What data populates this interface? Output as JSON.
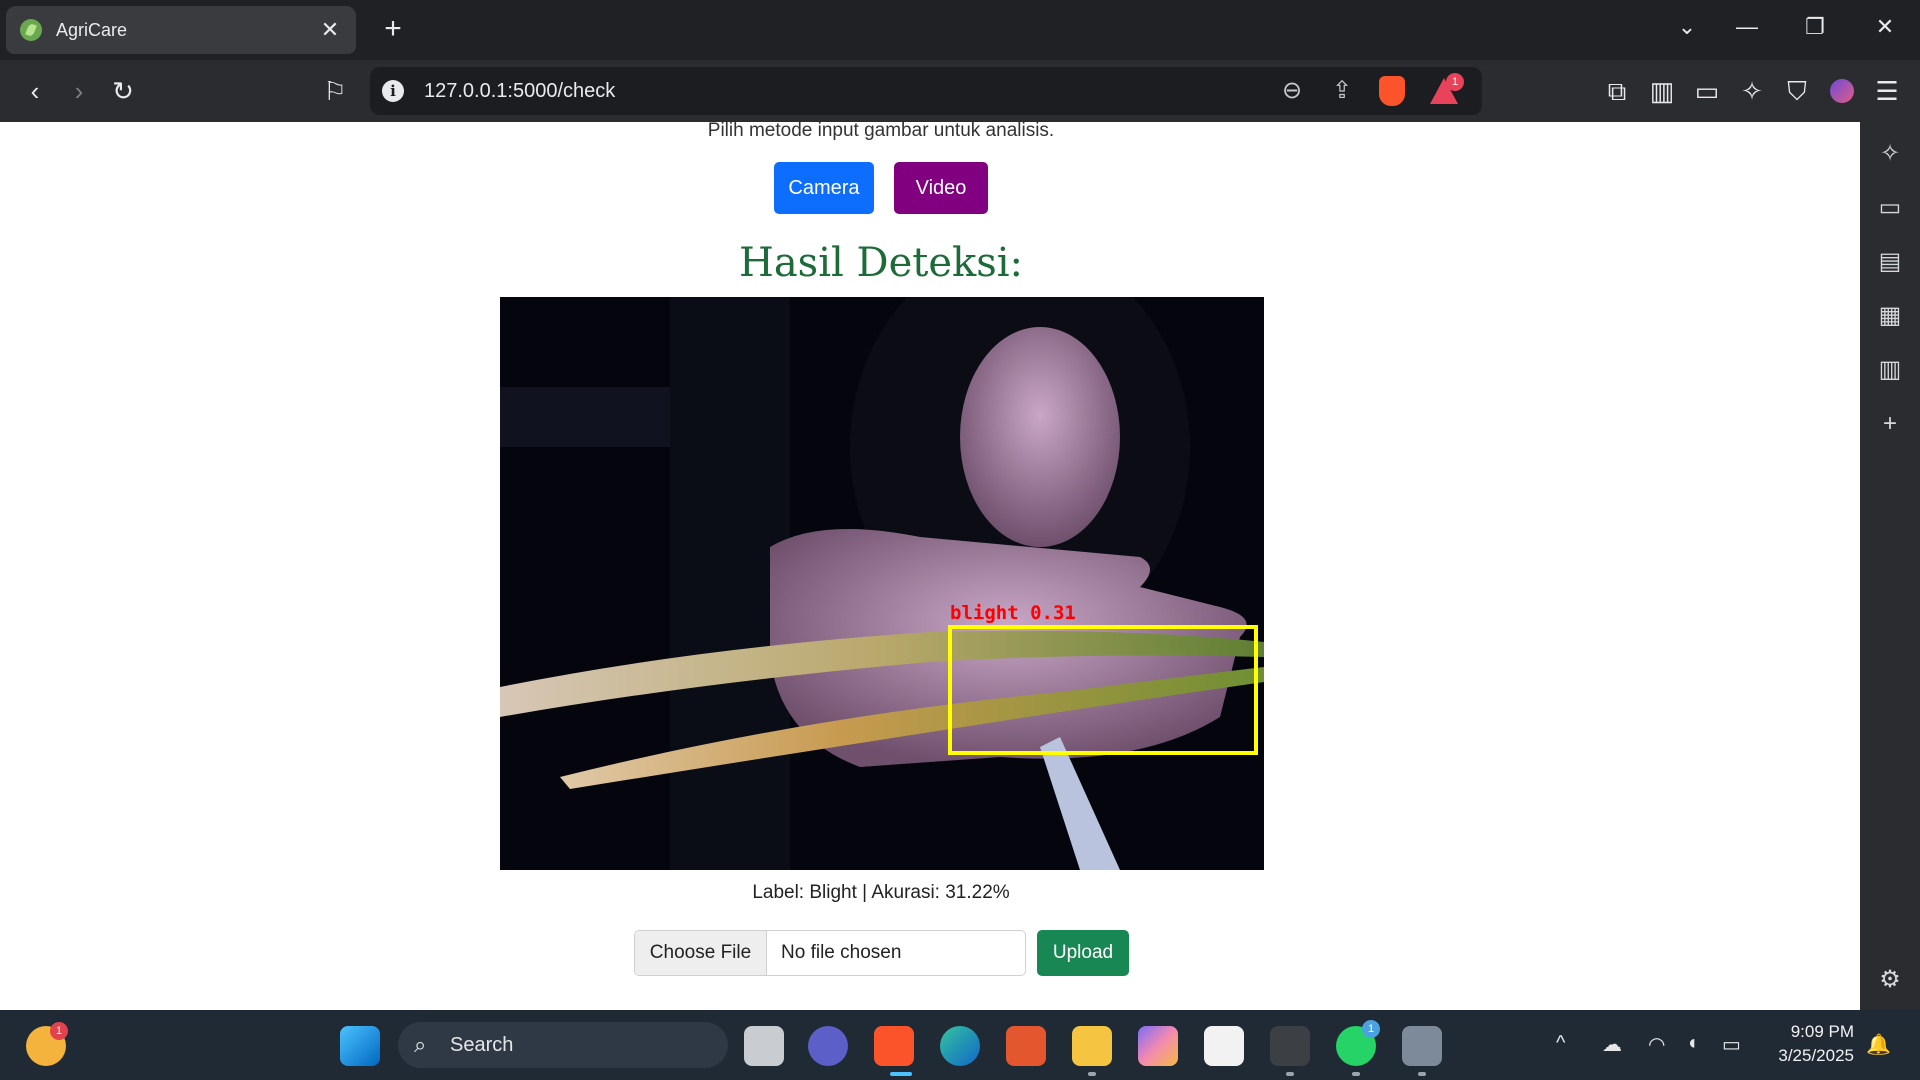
{
  "browser": {
    "tab_title": "AgriCare",
    "tab_close": "✕",
    "new_tab": "+",
    "url": "127.0.0.1:5000/check",
    "rewards_badge": "1"
  },
  "page": {
    "subtitle": "Pilih metode input gambar untuk analisis.",
    "camera_button": "Camera",
    "video_button": "Video",
    "heading": "Hasil Deteksi:",
    "detection_label": "blight 0.31",
    "caption": "Label: Blight | Akurasi: 31.22%",
    "choose_file": "Choose File",
    "file_status": "No file chosen",
    "upload_button": "Upload"
  },
  "taskbar": {
    "weather_badge": "1",
    "search_placeholder": "Search",
    "whatsapp_badge": "1",
    "time": "9:09 PM",
    "date": "3/25/2025"
  },
  "colors": {
    "camera_button": "#0d6efd",
    "video_button": "#800080",
    "upload_button": "#198754",
    "heading": "#1e6b3a",
    "bbox": "#ffff00",
    "bbox_label": "#ff0000"
  },
  "icons": {
    "tab_favicon": "leaf-icon",
    "back": "back-arrow-icon",
    "forward": "forward-arrow-icon",
    "reload": "reload-icon",
    "bookmark": "bookmark-icon",
    "zoom": "zoom-out-icon",
    "share": "share-icon",
    "brave": "brave-shields-icon",
    "rewards": "brave-rewards-icon"
  }
}
